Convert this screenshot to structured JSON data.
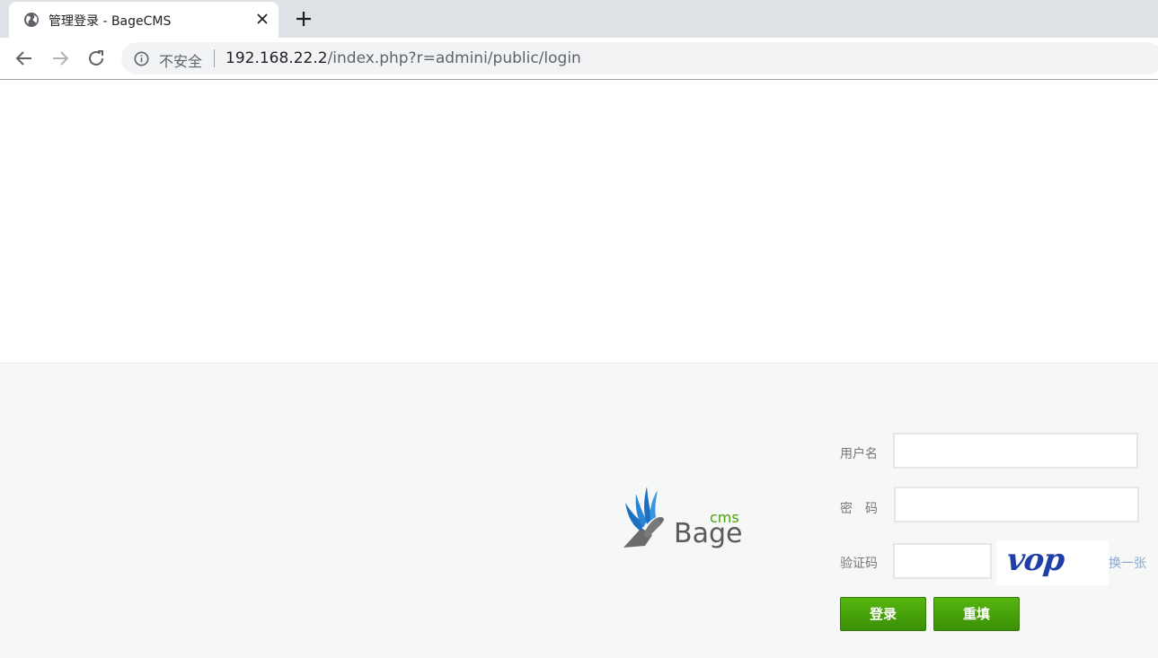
{
  "browser": {
    "tab": {
      "title": "管理登录 - BageCMS"
    },
    "omnibox": {
      "security_label": "不安全",
      "url_host": "192.168.22.2",
      "url_path": "/index.php?r=admini/public/login"
    }
  },
  "logo": {
    "small_text": "cms",
    "large_text": "Bage"
  },
  "login_form": {
    "username_label": "用户名",
    "password_label": "密　码",
    "captcha_label": "验证码",
    "captcha_text": "vop",
    "refresh_label": "换一张",
    "login_button": "登录",
    "reset_button": "重填",
    "username_value": "",
    "password_value": "",
    "captcha_value": ""
  },
  "colors": {
    "button_green": "#4aa10a",
    "link_blue": "#88a8cf",
    "captcha_blue": "#1f3fa8"
  }
}
